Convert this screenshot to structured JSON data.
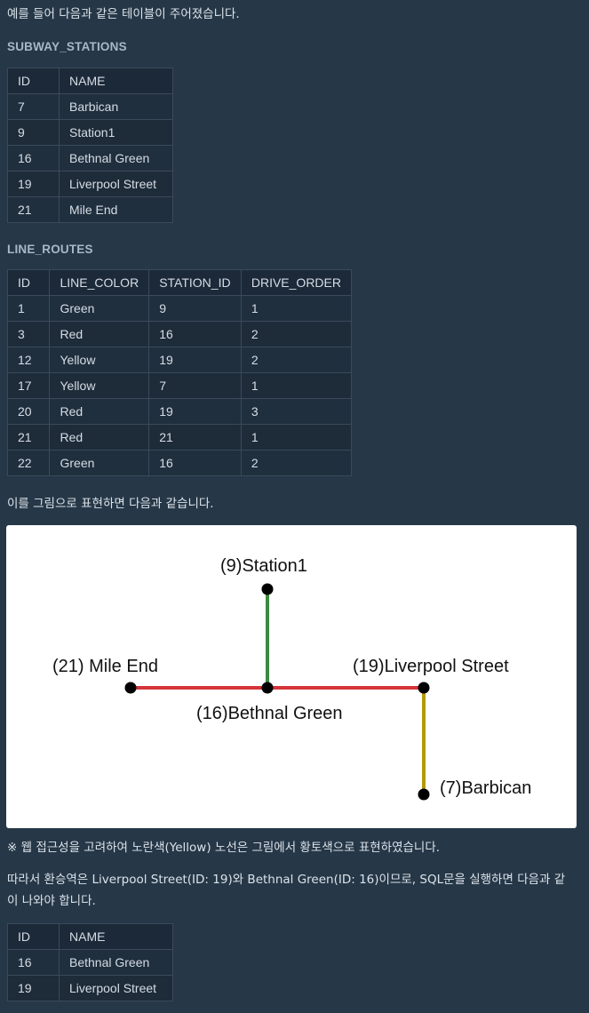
{
  "intro_text": "예를 들어 다음과 같은 테이블이 주어졌습니다.",
  "subway_stations": {
    "title": "SUBWAY_STATIONS",
    "columns": [
      "ID",
      "NAME"
    ],
    "rows": [
      [
        "7",
        "Barbican"
      ],
      [
        "9",
        "Station1"
      ],
      [
        "16",
        "Bethnal Green"
      ],
      [
        "19",
        "Liverpool Street"
      ],
      [
        "21",
        "Mile End"
      ]
    ]
  },
  "line_routes": {
    "title": "LINE_ROUTES",
    "columns": [
      "ID",
      "LINE_COLOR",
      "STATION_ID",
      "DRIVE_ORDER"
    ],
    "rows": [
      [
        "1",
        "Green",
        "9",
        "1"
      ],
      [
        "3",
        "Red",
        "16",
        "2"
      ],
      [
        "12",
        "Yellow",
        "19",
        "2"
      ],
      [
        "17",
        "Yellow",
        "7",
        "1"
      ],
      [
        "20",
        "Red",
        "19",
        "3"
      ],
      [
        "21",
        "Red",
        "21",
        "1"
      ],
      [
        "22",
        "Green",
        "16",
        "2"
      ]
    ]
  },
  "diagram_caption": "이를 그림으로 표현하면 다음과 같습니다.",
  "diagram": {
    "labels": {
      "station1": "(9)Station1",
      "mile_end": "(21) Mile End",
      "liverpool": "(19)Liverpool Street",
      "bethnal": "(16)Bethnal Green",
      "barbican": "(7)Barbican"
    },
    "colors": {
      "green": "#3c8a3f",
      "red": "#d4343a",
      "yellow": "#b39a06",
      "node": "#000000"
    }
  },
  "note_text": "※ 웹 접근성을 고려하여 노란색(Yellow) 노선은 그림에서 황토색으로 표현하였습니다.",
  "conclusion_line1": "따라서 환승역은 Liverpool Street(ID: 19)와 Bethnal Green(ID: 16)이므로, SQL문을 실행하면 다음과 같",
  "conclusion_line2": "이 나와야 합니다.",
  "result": {
    "columns": [
      "ID",
      "NAME"
    ],
    "rows": [
      [
        "16",
        "Bethnal Green"
      ],
      [
        "19",
        "Liverpool Street"
      ]
    ]
  }
}
